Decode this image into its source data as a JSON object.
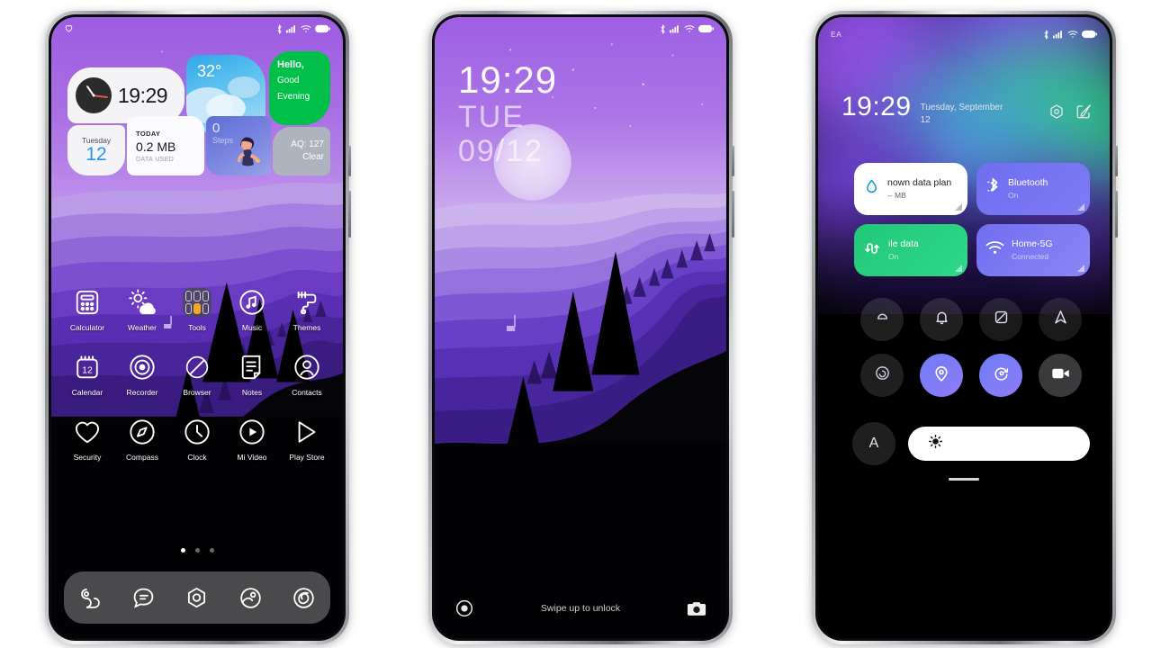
{
  "phone1": {
    "name": "home-screen",
    "statusbar": {
      "left_icon": "heart-icon",
      "icons": [
        "bluetooth-icon",
        "signal-icon",
        "wifi-icon",
        "battery-icon"
      ]
    },
    "widgets": {
      "clock": {
        "time": "19:29",
        "icon": "analog-clock-icon"
      },
      "weather": {
        "temperature": "32°",
        "icon": "cloud-icon"
      },
      "greeting": {
        "line1": "Hello,",
        "line2": "Good",
        "line3": "Evening"
      },
      "day": {
        "weekday": "Tuesday",
        "date": "12"
      },
      "data": {
        "label": "TODAY",
        "value": "0.2 MB",
        "sub": "DATA USED"
      },
      "steps": {
        "count": "0",
        "label": "Steps"
      },
      "air": {
        "line1": "AQ: 127",
        "line2": "Clear"
      }
    },
    "apps": [
      [
        {
          "label": "Calculator",
          "icon": "calculator-icon"
        },
        {
          "label": "Weather",
          "icon": "sun-cloud-icon"
        },
        {
          "label": "Tools",
          "icon": "folder-icon"
        },
        {
          "label": "Music",
          "icon": "music-note-icon"
        },
        {
          "label": "Themes",
          "icon": "paint-roller-icon"
        }
      ],
      [
        {
          "label": "Calendar",
          "icon": "calendar-icon",
          "badge": "12"
        },
        {
          "label": "Recorder",
          "icon": "record-circle-icon"
        },
        {
          "label": "Browser",
          "icon": "leaf-globe-icon"
        },
        {
          "label": "Notes",
          "icon": "note-page-icon"
        },
        {
          "label": "Contacts",
          "icon": "person-circle-icon"
        }
      ],
      [
        {
          "label": "Security",
          "icon": "heart-shield-icon"
        },
        {
          "label": "Compass",
          "icon": "compass-icon"
        },
        {
          "label": "Clock",
          "icon": "clock-icon"
        },
        {
          "label": "Mi Video",
          "icon": "play-circle-icon"
        },
        {
          "label": "Play Store",
          "icon": "play-store-icon"
        }
      ]
    ],
    "page_dots": {
      "count": 3,
      "active": 1
    },
    "dock": [
      {
        "name": "phone-icon"
      },
      {
        "name": "messages-icon"
      },
      {
        "name": "settings-icon"
      },
      {
        "name": "gallery-icon"
      },
      {
        "name": "camera-icon"
      }
    ]
  },
  "phone2": {
    "name": "lock-screen",
    "statusbar": {
      "icons": [
        "bluetooth-icon",
        "signal-icon",
        "wifi-icon",
        "battery-icon"
      ]
    },
    "clock": {
      "time": "19:29",
      "weekday": "TUE",
      "date": "09/12"
    },
    "bottom": {
      "left_icon": "fingerprint-icon",
      "hint": "Swipe up to unlock",
      "right_icon": "camera-icon"
    }
  },
  "phone3": {
    "name": "control-center",
    "statusbar": {
      "carrier": "EA",
      "icons": [
        "bluetooth-icon",
        "signal-icon",
        "wifi-icon",
        "battery-icon"
      ]
    },
    "header": {
      "time": "19:29",
      "date": "Tuesday, September 12",
      "actions": [
        {
          "name": "settings-icon"
        },
        {
          "name": "edit-icon"
        }
      ]
    },
    "tiles": [
      {
        "title": "nown data plan",
        "sub": "-- MB",
        "icon": "data-drop-icon",
        "style": "white"
      },
      {
        "title": "Bluetooth",
        "sub": "On",
        "icon": "bluetooth-icon",
        "style": "blue"
      },
      {
        "title": "ile data",
        "sub": "On",
        "icon": "mobile-data-icon",
        "style": "green"
      },
      {
        "title": "Home-5G",
        "sub": "Connected",
        "icon": "wifi-icon",
        "style": "blue2"
      }
    ],
    "toggles": [
      {
        "name": "silent-icon",
        "state": "off"
      },
      {
        "name": "bell-icon",
        "state": "off"
      },
      {
        "name": "screenshot-icon",
        "state": "dark"
      },
      {
        "name": "navigation-icon",
        "state": "dark"
      },
      {
        "name": "sync-icon",
        "state": "off"
      },
      {
        "name": "location-icon",
        "state": "on"
      },
      {
        "name": "auto-rotate-icon",
        "state": "on"
      },
      {
        "name": "screen-record-icon",
        "state": "grey"
      }
    ],
    "brightness": {
      "auto_label": "A",
      "icon": "brightness-sun-icon",
      "value": 100
    }
  },
  "colors": {
    "accent_purple": "#7b4ddb",
    "green": "#00c04a",
    "blue": "#2196f3",
    "tile_blue": "#6f6ef0",
    "tile_green": "#20c776"
  }
}
